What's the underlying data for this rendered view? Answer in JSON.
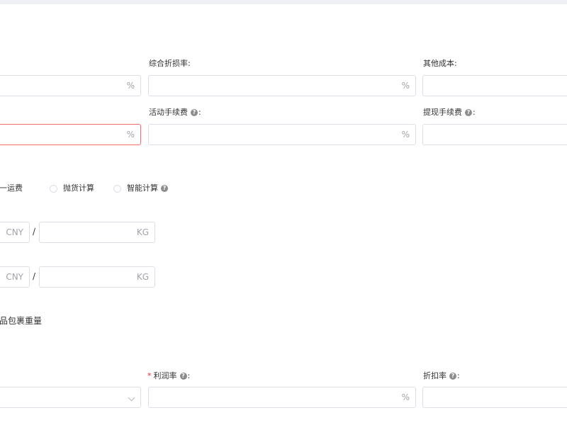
{
  "row1": {
    "comprehensive_loss_rate": {
      "label": "综合折损率:",
      "suffix": "%"
    },
    "first_field": {
      "suffix": "%"
    },
    "other_cost": {
      "label": "其他成本:"
    }
  },
  "row2": {
    "first_field": {
      "suffix": "%"
    },
    "activity_fee": {
      "label": "活动手续费",
      "suffix": "%"
    },
    "withdraw_fee": {
      "label": "提现手续费"
    }
  },
  "help_glyph": "?",
  "colon": ":",
  "shipping": {
    "options": [
      "统一运费",
      "抛货计算",
      "智能计算"
    ]
  },
  "weight_rows": [
    {
      "currency": "CNY",
      "separator": "/",
      "unit": "KG"
    },
    {
      "currency": "CNY",
      "separator": "/",
      "unit": "KG"
    }
  ],
  "package_weight_label": "品包裹重量",
  "bottom": {
    "profit_rate": {
      "required_mark": "*",
      "label": "利润率",
      "suffix": "%"
    },
    "discount_rate": {
      "label": "折扣率"
    }
  }
}
